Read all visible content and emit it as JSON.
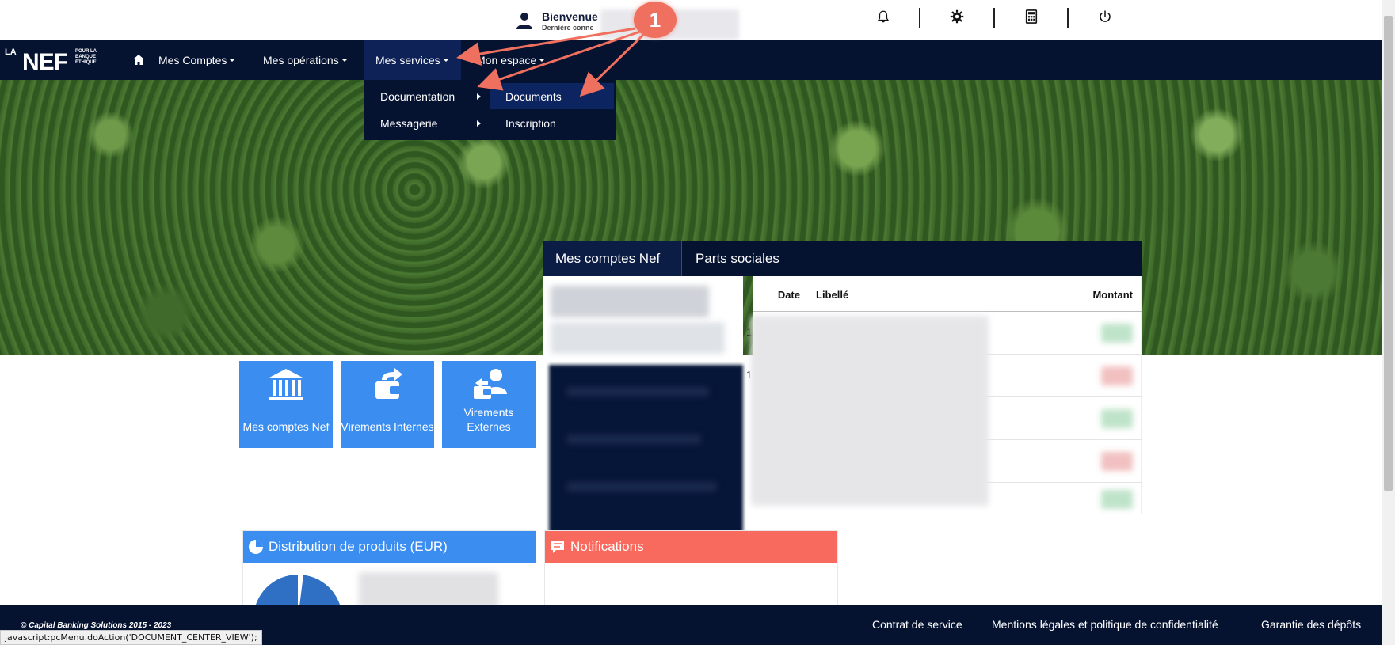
{
  "header": {
    "welcome": "Bienvenue",
    "last_login": "Dernière conne"
  },
  "icons": {
    "user": "user-icon",
    "bell": "bell-icon",
    "settings": "gear-icon",
    "calculator": "calculator-icon",
    "logout": "power-icon",
    "home": "home-icon"
  },
  "logo": {
    "la": "LA",
    "nef": "NEF",
    "tagline": "POUR LA BANQUE ÉTHIQUE"
  },
  "nav": {
    "items": [
      {
        "label": "Mes Comptes"
      },
      {
        "label": "Mes opérations"
      },
      {
        "label": "Mes services"
      },
      {
        "label": "Mon espace"
      }
    ]
  },
  "dropdown": {
    "level1": [
      "Documentation",
      "Messagerie"
    ],
    "level2": [
      "Documents",
      "Inscription"
    ]
  },
  "tiles": [
    {
      "label": "Mes comptes Nef",
      "icon": "bank-icon"
    },
    {
      "label": "Virements Internes",
      "icon": "internal-transfer-icon"
    },
    {
      "label": "Virements Externes",
      "icon": "external-transfer-icon"
    }
  ],
  "accounts": {
    "tabs": [
      "Mes comptes Nef",
      "Parts sociales"
    ],
    "columns": [
      "Date",
      "Libellé",
      "Montant"
    ],
    "row_digits": [
      "1",
      "1"
    ]
  },
  "panels": {
    "distribution": "Distribution de produits (EUR)",
    "notifications": "Notifications"
  },
  "footer": {
    "copyright": "© Capital Banking Solutions 2015 - 2023",
    "links": [
      "Contrat de service",
      "Mentions légales et politique de confidentialité",
      "Garantie des dépôts"
    ]
  },
  "statusbar": "javascript:pcMenu.doAction('DOCUMENT_CENTER_VIEW');",
  "annotation": "1",
  "colors": {
    "navy": "#051331",
    "tile_blue": "#3b8ef0",
    "notifications_red": "#f86a5d",
    "annotation": "#f07060"
  }
}
